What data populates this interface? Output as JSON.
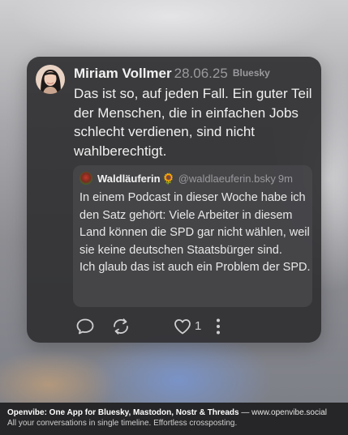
{
  "post": {
    "author": "Miriam Vollmer",
    "date": "28.06.25",
    "network": "Bluesky",
    "text": "Das ist so, auf jeden Fall. Ein guter Teil der Menschen, die in einfachen Jobs schlecht verdienen, sind nicht wahlberechtigt.",
    "avatar_icon": "user-avatar-photo"
  },
  "quote": {
    "author": "Waldläuferin",
    "emoji": "🌻",
    "handle": "@waldlaeuferin.bsky",
    "time": "9m",
    "text": "In einem Podcast in dieser Woche habe ich den Satz gehört: Viele Arbeiter in diesem Land können die SPD gar nicht wählen, weil sie keine deutschen Staatsbürger sind.\nIch glaub das ist auch ein Problem der SPD."
  },
  "actions": {
    "like_count": "1",
    "icons": [
      "reply-icon",
      "repost-icon",
      "like-icon",
      "more-options-icon"
    ]
  },
  "footer": {
    "brand": "Openvibe: One App for Bluesky, Mastodon, Nostr & Threads",
    "separator": " — ",
    "url": "www.openvibe.social",
    "tagline": "All your conversations in single timeline. Effortless crossposting."
  },
  "colors": {
    "card_bg": "#2e2e30",
    "quote_bg": "#48484b",
    "text_primary": "#f0f0f0",
    "text_muted": "#9a9a9e",
    "footer_bg": "#262628"
  }
}
